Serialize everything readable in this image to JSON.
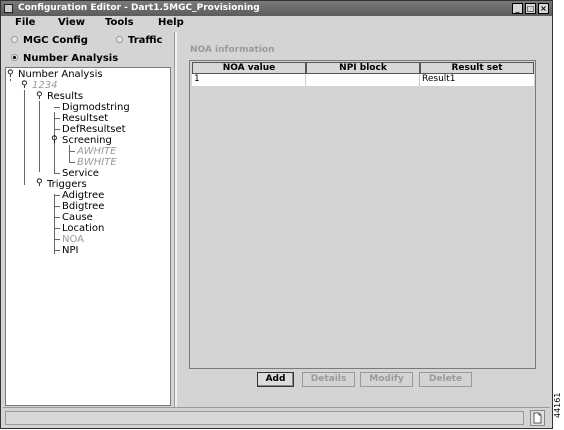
{
  "window": {
    "title": "Configuration Editor - Dart1.5MGC_Provisioning"
  },
  "menu": {
    "items": [
      "File",
      "View",
      "Tools",
      "Help"
    ]
  },
  "radios": {
    "mgc_config": "MGC Config",
    "traffic": "Traffic",
    "number_analysis": "Number Analysis",
    "selected": "number_analysis"
  },
  "tree": {
    "root": "Number Analysis",
    "child": "1234",
    "results": "Results",
    "digmodstring": "Digmodstring",
    "resultset": "Resultset",
    "defresultset": "DefResultset",
    "screening": "Screening",
    "awhite": "AWHITE",
    "bwhite": "BWHITE",
    "service": "Service",
    "triggers": "Triggers",
    "adigtree": "Adigtree",
    "bdigtree": "Bdigtree",
    "cause": "Cause",
    "location": "Location",
    "noa": "NOA",
    "npi": "NPI"
  },
  "panel": {
    "title": "NOA information"
  },
  "table": {
    "columns": [
      "NOA value",
      "NPI block",
      "Result set"
    ],
    "rows": [
      [
        "1",
        "",
        "Result1"
      ]
    ]
  },
  "buttons": {
    "add": "Add",
    "details": "Details",
    "modify": "Modify",
    "delete": "Delete"
  },
  "figure_id": "44161"
}
